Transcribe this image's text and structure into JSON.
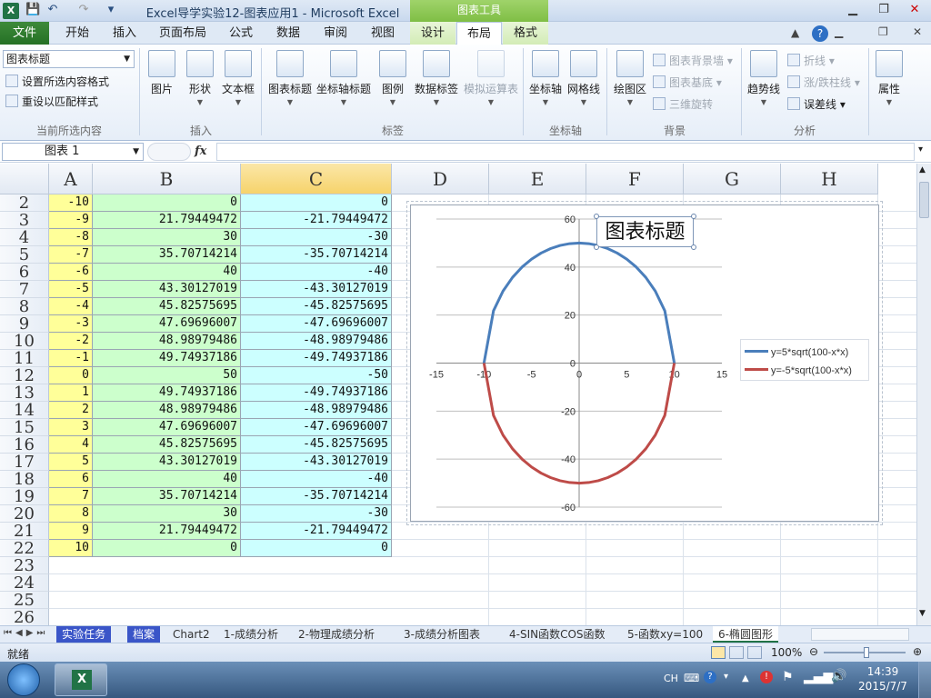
{
  "window": {
    "title": "Excel导学实验12-图表应用1  -  Microsoft Excel",
    "context_group": "图表工具"
  },
  "tabs": [
    {
      "label": "文件",
      "kind": "file"
    },
    {
      "label": "开始"
    },
    {
      "label": "插入"
    },
    {
      "label": "页面布局"
    },
    {
      "label": "公式"
    },
    {
      "label": "数据"
    },
    {
      "label": "审阅"
    },
    {
      "label": "视图"
    },
    {
      "label": "设计",
      "kind": "ctx"
    },
    {
      "label": "布局",
      "kind": "ctx",
      "active": true
    },
    {
      "label": "格式",
      "kind": "ctx"
    }
  ],
  "ribbon": {
    "current_selection": {
      "combo_value": "图表标题",
      "format_selection": "设置所选内容格式",
      "reset_style": "重设以匹配样式",
      "group_label": "当前所选内容"
    },
    "insert": {
      "picture": "图片",
      "shapes": "形状",
      "textbox": "文本框",
      "group_label": "插入"
    },
    "labels": {
      "chart_title": "图表标题",
      "axis_titles": "坐标轴标题",
      "legend": "图例",
      "data_labels": "数据标签",
      "data_table": "模拟运算表",
      "group_label": "标签"
    },
    "axes": {
      "axes": "坐标轴",
      "gridlines": "网格线",
      "group_label": "坐标轴"
    },
    "background": {
      "plot_area": "绘图区",
      "chart_wall": "图表背景墙",
      "chart_floor": "图表基底",
      "rotation": "三维旋转",
      "group_label": "背景"
    },
    "analysis": {
      "trendline": "趋势线",
      "lines": "折线",
      "updown": "涨/跌柱线",
      "errorbars": "误差线",
      "group_label": "分析"
    },
    "properties": {
      "label": "属性"
    }
  },
  "formula_bar": {
    "name_box": "图表 1",
    "fx": "fx",
    "formula": ""
  },
  "columns": [
    "A",
    "B",
    "C",
    "D",
    "E",
    "F",
    "G",
    "H"
  ],
  "rows": [
    "2",
    "3",
    "4",
    "5",
    "6",
    "7",
    "8",
    "9",
    "10",
    "11",
    "12",
    "13",
    "14",
    "15",
    "16",
    "17",
    "18",
    "19",
    "20",
    "21",
    "22",
    "23",
    "24",
    "25",
    "26"
  ],
  "cells": [
    [
      "-10",
      "0",
      "0"
    ],
    [
      "-9",
      "21.79449472",
      "-21.79449472"
    ],
    [
      "-8",
      "30",
      "-30"
    ],
    [
      "-7",
      "35.70714214",
      "-35.70714214"
    ],
    [
      "-6",
      "40",
      "-40"
    ],
    [
      "-5",
      "43.30127019",
      "-43.30127019"
    ],
    [
      "-4",
      "45.82575695",
      "-45.82575695"
    ],
    [
      "-3",
      "47.69696007",
      "-47.69696007"
    ],
    [
      "-2",
      "48.98979486",
      "-48.98979486"
    ],
    [
      "-1",
      "49.74937186",
      "-49.74937186"
    ],
    [
      "0",
      "50",
      "-50"
    ],
    [
      "1",
      "49.74937186",
      "-49.74937186"
    ],
    [
      "2",
      "48.98979486",
      "-48.98979486"
    ],
    [
      "3",
      "47.69696007",
      "-47.69696007"
    ],
    [
      "4",
      "45.82575695",
      "-45.82575695"
    ],
    [
      "5",
      "43.30127019",
      "-43.30127019"
    ],
    [
      "6",
      "40",
      "-40"
    ],
    [
      "7",
      "35.70714214",
      "-35.70714214"
    ],
    [
      "8",
      "30",
      "-30"
    ],
    [
      "9",
      "21.79449472",
      "-21.79449472"
    ],
    [
      "10",
      "0",
      "0"
    ]
  ],
  "chart_data": {
    "type": "line",
    "title": "图表标题",
    "xlabel": "",
    "ylabel": "",
    "xlim": [
      -15,
      15
    ],
    "ylim": [
      -60,
      60
    ],
    "xticks": [
      "-15",
      "-10",
      "-5",
      "0",
      "5",
      "10",
      "15"
    ],
    "yticks": [
      "-60",
      "-40",
      "-20",
      "0",
      "20",
      "40",
      "60"
    ],
    "grid": true,
    "legend": "right",
    "x": [
      -10,
      -9,
      -8,
      -7,
      -6,
      -5,
      -4,
      -3,
      -2,
      -1,
      0,
      1,
      2,
      3,
      4,
      5,
      6,
      7,
      8,
      9,
      10
    ],
    "series": [
      {
        "name": "y=5*sqrt(100-x*x)",
        "color": "#4a7ebb",
        "values": [
          0,
          21.79449472,
          30,
          35.70714214,
          40,
          43.30127019,
          45.82575695,
          47.69696007,
          48.98979486,
          49.74937186,
          50,
          49.74937186,
          48.98979486,
          47.69696007,
          45.82575695,
          43.30127019,
          40,
          35.70714214,
          30,
          21.79449472,
          0
        ]
      },
      {
        "name": "y=-5*sqrt(100-x*x)",
        "color": "#be4b48",
        "values": [
          0,
          -21.79449472,
          -30,
          -35.70714214,
          -40,
          -43.30127019,
          -45.82575695,
          -47.69696007,
          -48.98979486,
          -49.74937186,
          -50,
          -49.74937186,
          -48.98979486,
          -47.69696007,
          -45.82575695,
          -43.30127019,
          -40,
          -35.70714214,
          -30,
          -21.79449472,
          0
        ]
      }
    ]
  },
  "sheet_tabs": [
    "实验任务",
    "档案",
    "Chart2",
    "1-成绩分析",
    "2-物理成绩分析",
    "3-成绩分析图表",
    "4-SIN函数COS函数",
    "5-函数xy=100",
    "6-椭圆图形"
  ],
  "status": {
    "ready": "就绪",
    "zoom": "100%"
  },
  "taskbar": {
    "lang": "CH",
    "time": "14:39",
    "date": "2015/7/7"
  }
}
